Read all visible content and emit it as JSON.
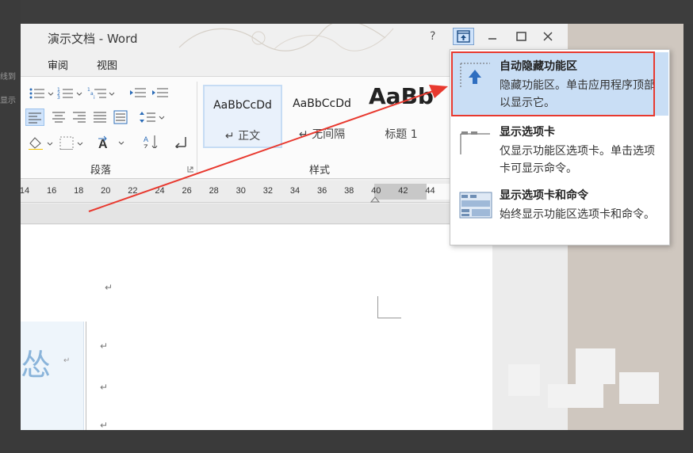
{
  "window": {
    "title": "演示文档 - Word",
    "help_label": "?"
  },
  "tabs": [
    {
      "label": "审阅"
    },
    {
      "label": "视图"
    }
  ],
  "ribbon": {
    "paragraph_group_label": "段落",
    "styles_group_label": "样式",
    "styles": [
      {
        "sample": "AaBbCcDd",
        "name": "↵ 正文"
      },
      {
        "sample": "AaBbCcDd",
        "name": "↵ 无间隔"
      },
      {
        "sample": "AaBb",
        "name": "标题 1"
      }
    ]
  },
  "ruler": {
    "ticks": [
      "14",
      "16",
      "18",
      "20",
      "22",
      "24",
      "26",
      "28",
      "30",
      "32",
      "34",
      "36",
      "38",
      "40",
      "42",
      "44"
    ]
  },
  "side_left_text": [
    "线到",
    "显示"
  ],
  "document": {
    "textbox_char": "怂",
    "textbox_mark": "↵",
    "paragraph_mark": "↵"
  },
  "ribbon_display_menu": {
    "items": [
      {
        "title": "自动隐藏功能区",
        "desc": "隐藏功能区。单击应用程序顶部以显示它。",
        "icon": "auto-hide-ribbon-icon",
        "selected": true
      },
      {
        "title": "显示选项卡",
        "desc": "仅显示功能区选项卡。单击选项卡可显示命令。",
        "icon": "show-tabs-icon",
        "selected": false
      },
      {
        "title": "显示选项卡和命令",
        "desc": "始终显示功能区选项卡和命令。",
        "icon": "show-tabs-commands-icon",
        "selected": false
      }
    ]
  },
  "colors": {
    "highlight_border": "#e8392f",
    "selected_bg": "#c9def5",
    "arrow": "#e8392f"
  }
}
